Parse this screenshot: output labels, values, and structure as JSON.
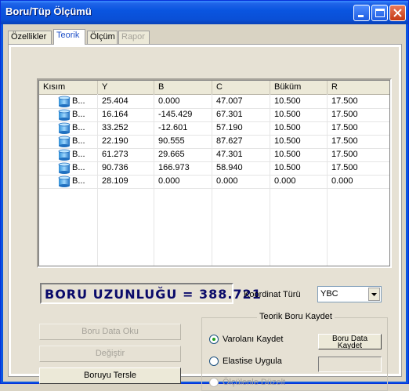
{
  "window": {
    "title": "Boru/Tüp Ölçümü"
  },
  "tabs": [
    {
      "label": "Özellikler",
      "state": "normal"
    },
    {
      "label": "Teorik",
      "state": "active"
    },
    {
      "label": "Ölçüm",
      "state": "normal"
    },
    {
      "label": "Rapor",
      "state": "disabled"
    }
  ],
  "table": {
    "columns": [
      "Kısım",
      "Y",
      "B",
      "C",
      "Büküm",
      "R"
    ],
    "rows": [
      {
        "kisim": "B...",
        "y": "25.404",
        "b": "0.000",
        "c": "47.007",
        "bukum": "10.500",
        "r": "17.500"
      },
      {
        "kisim": "B...",
        "y": "16.164",
        "b": "-145.429",
        "c": "67.301",
        "bukum": "10.500",
        "r": "17.500"
      },
      {
        "kisim": "B...",
        "y": "33.252",
        "b": "-12.601",
        "c": "57.190",
        "bukum": "10.500",
        "r": "17.500"
      },
      {
        "kisim": "B...",
        "y": "22.190",
        "b": "90.555",
        "c": "87.627",
        "bukum": "10.500",
        "r": "17.500"
      },
      {
        "kisim": "B...",
        "y": "61.273",
        "b": "29.665",
        "c": "47.301",
        "bukum": "10.500",
        "r": "17.500"
      },
      {
        "kisim": "B...",
        "y": "90.736",
        "b": "166.973",
        "c": "58.940",
        "bukum": "10.500",
        "r": "17.500"
      },
      {
        "kisim": "B...",
        "y": "28.109",
        "b": "0.000",
        "c": "0.000",
        "bukum": "0.000",
        "r": "0.000"
      }
    ]
  },
  "length": {
    "text": "BORU UZUNLUĞU = 388.721"
  },
  "coordinate": {
    "label": "Koordinat Türü",
    "value": "YBC"
  },
  "buttons": {
    "read_data": "Boru Data Oku",
    "change": "Değiştir",
    "reverse": "Boruyu Tersle"
  },
  "group": {
    "title": "Teorik Boru Kaydet",
    "options": [
      {
        "label": "Varolanı Kaydet",
        "checked": true,
        "disabled": false
      },
      {
        "label": "Elastise Uygula",
        "checked": false,
        "disabled": false
      },
      {
        "label": "Ölçülenle Düzelt",
        "checked": false,
        "disabled": true
      }
    ],
    "save_button_line1": "Boru Data",
    "save_button_line2": "Kaydet"
  },
  "colors": {
    "titlebar": "#0a55e0",
    "panel": "#e6e1d4",
    "length_text": "#0a0a6a",
    "active_tab": "#1e50c8"
  },
  "icons": {
    "row_icon": "cylinder-icon",
    "dropdown": "chevron-down-icon"
  }
}
